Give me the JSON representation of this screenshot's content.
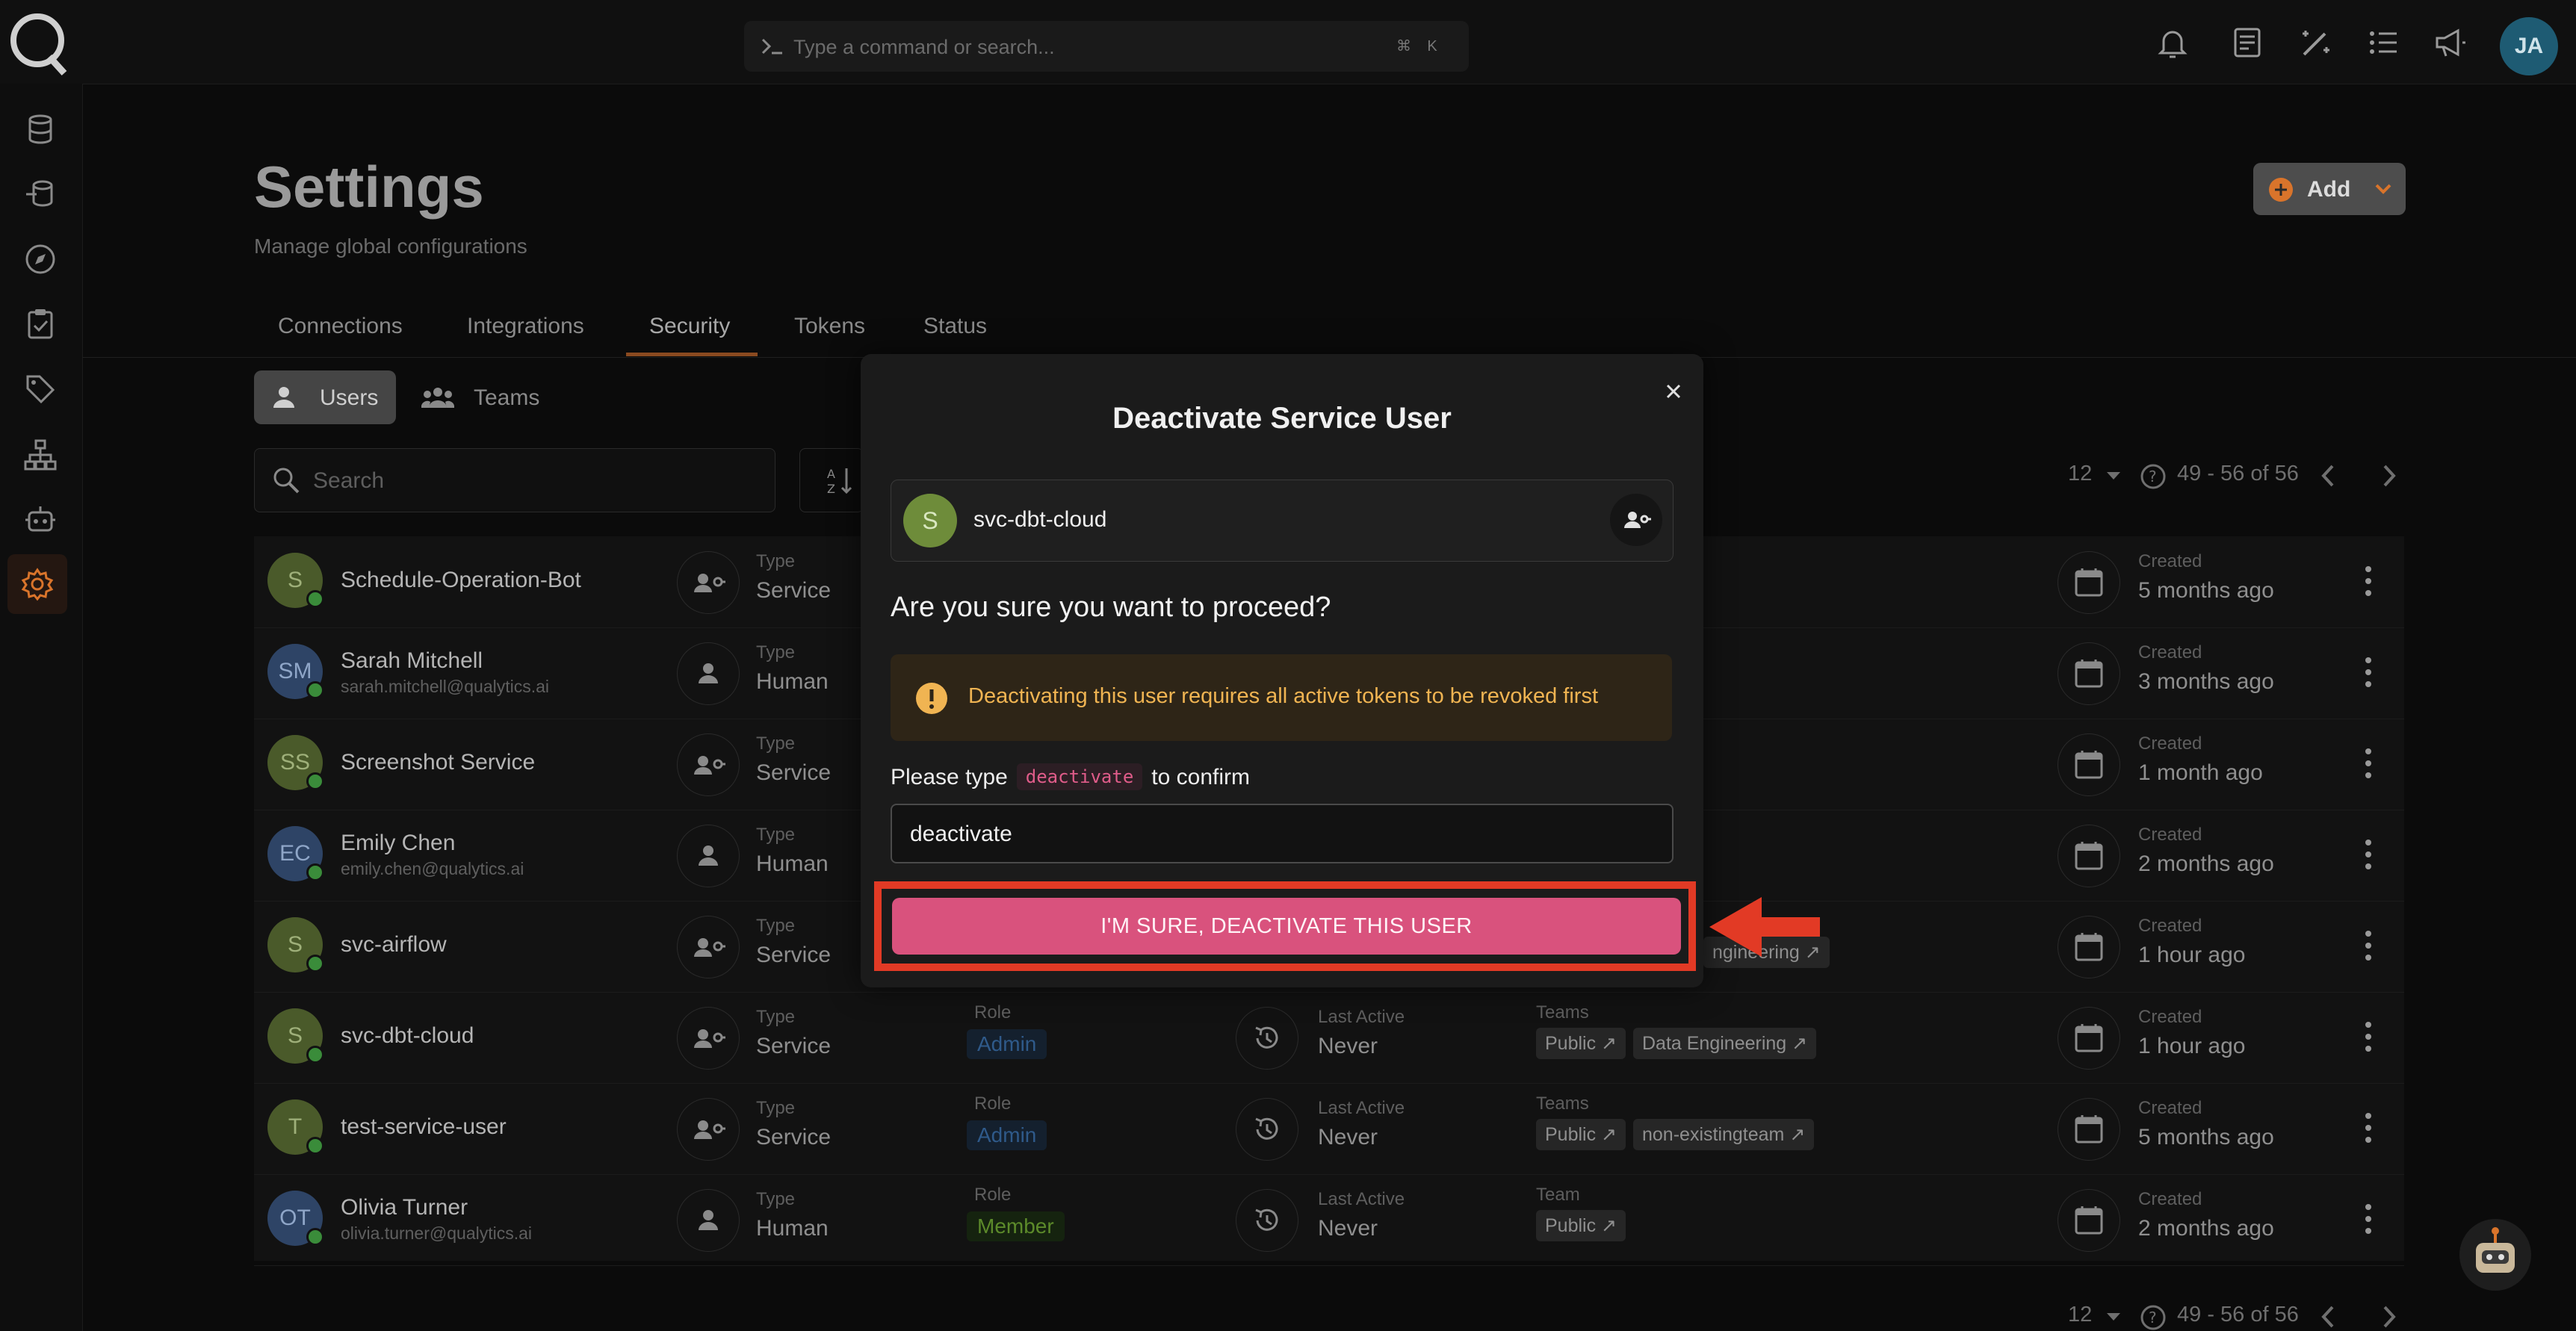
{
  "topbar": {
    "command_placeholder": "Type a command or search...",
    "shortcut_cmd": "⌘",
    "shortcut_key": "K",
    "user_initials": "JA"
  },
  "page": {
    "title": "Settings",
    "subtitle": "Manage global configurations",
    "add_label": "Add",
    "tabs": [
      "Connections",
      "Integrations",
      "Security",
      "Tokens",
      "Status"
    ],
    "active_tab": "Security",
    "subtabs": [
      "Users",
      "Teams"
    ],
    "search_placeholder": "Search",
    "pagination": {
      "page_size": "12",
      "range": "49 - 56 of 56"
    }
  },
  "users": [
    {
      "initials": "S",
      "name": "Schedule-Operation-Bot",
      "email": "",
      "type_label": "Type",
      "type": "Service",
      "created_label": "Created",
      "created": "5 months ago"
    },
    {
      "initials": "SM",
      "name": "Sarah Mitchell",
      "email": "sarah.mitchell@qualytics.ai",
      "type_label": "Type",
      "type": "Human",
      "created_label": "Created",
      "created": "3 months ago"
    },
    {
      "initials": "SS",
      "name": "Screenshot Service",
      "email": "",
      "type_label": "Type",
      "type": "Service",
      "created_label": "Created",
      "created": "1 month ago"
    },
    {
      "initials": "EC",
      "name": "Emily Chen",
      "email": "emily.chen@qualytics.ai",
      "type_label": "Type",
      "type": "Human",
      "created_label": "Created",
      "created": "2 months ago"
    },
    {
      "initials": "S",
      "name": "svc-airflow",
      "email": "",
      "type_label": "Type",
      "type": "Service",
      "team_fragment": "ngineering ↗",
      "created_label": "Created",
      "created": "1 hour ago"
    },
    {
      "initials": "S",
      "name": "svc-dbt-cloud",
      "email": "",
      "type_label": "Type",
      "type": "Service",
      "role_label": "Role",
      "role": "Admin",
      "active_label": "Last Active",
      "active": "Never",
      "teams_label": "Teams",
      "teams": [
        "Public ↗",
        "Data Engineering ↗"
      ],
      "created_label": "Created",
      "created": "1 hour ago"
    },
    {
      "initials": "T",
      "name": "test-service-user",
      "email": "",
      "type_label": "Type",
      "type": "Service",
      "role_label": "Role",
      "role": "Admin",
      "active_label": "Last Active",
      "active": "Never",
      "teams_label": "Teams",
      "teams": [
        "Public ↗",
        "non-existingteam ↗"
      ],
      "created_label": "Created",
      "created": "5 months ago"
    },
    {
      "initials": "OT",
      "name": "Olivia Turner",
      "email": "olivia.turner@qualytics.ai",
      "type_label": "Type",
      "type": "Human",
      "role_label": "Role",
      "role": "Member",
      "active_label": "Last Active",
      "active": "Never",
      "teams_label": "Team",
      "teams": [
        "Public ↗"
      ],
      "created_label": "Created",
      "created": "2 months ago"
    }
  ],
  "modal": {
    "title": "Deactivate Service User",
    "user_initial": "S",
    "user_name": "svc-dbt-cloud",
    "question": "Are you sure you want to proceed?",
    "warning": "Deactivating this user requires all active tokens to be revoked first",
    "confirm_prefix": "Please type",
    "confirm_code": "deactivate",
    "confirm_suffix": "to confirm",
    "input_value": "deactivate",
    "confirm_button": "I'M SURE, DEACTIVATE THIS USER"
  },
  "colors": {
    "accent_orange": "#d9742b",
    "danger_button": "#d9527d",
    "highlight_red": "#e23a25",
    "warning_text": "#f0b452"
  }
}
